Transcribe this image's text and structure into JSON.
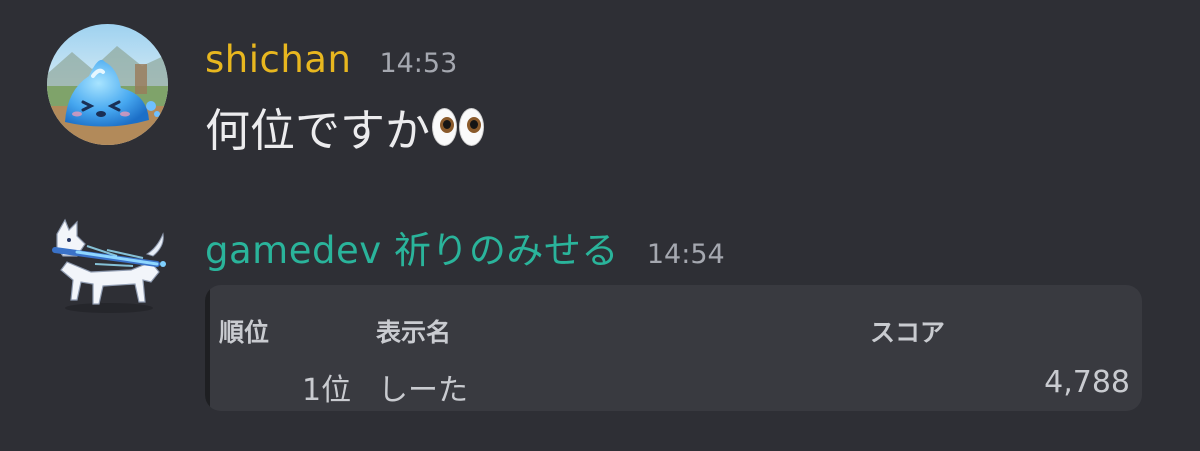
{
  "messages": [
    {
      "username": "shichan",
      "username_color": "#e8b71f",
      "timestamp": "14:53",
      "text": "何位ですか",
      "emoji": "eyes-emoji"
    },
    {
      "username": "gamedev 祈りのみせる",
      "username_color": "#2ab49b",
      "timestamp": "14:54",
      "embed": {
        "headers": {
          "rank": "順位",
          "name": "表示名",
          "score": "スコア"
        },
        "rows": [
          {
            "rank": "1位",
            "name": "しーた",
            "score": "4,788"
          }
        ]
      }
    }
  ],
  "colors": {
    "background": "#2e2f35",
    "embed_background": "#393a40",
    "timestamp": "#a5a8b0"
  }
}
